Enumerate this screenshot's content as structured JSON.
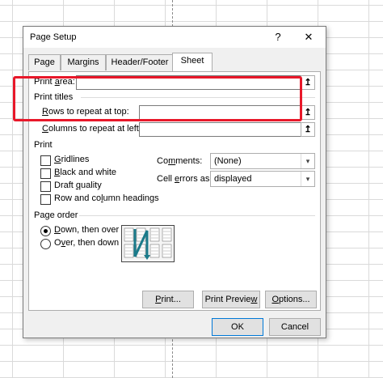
{
  "dialog": {
    "title": "Page Setup",
    "help_glyph": "?",
    "close_glyph": "✕"
  },
  "tabs": [
    "Page",
    "Margins",
    "Header/Footer",
    "Sheet"
  ],
  "sheet": {
    "print_area": {
      "label_u": "a",
      "label_rest": "rea:",
      "label_pre": "Print "
    },
    "print_titles": {
      "heading": "Print titles"
    },
    "rows_repeat": {
      "label_u": "R",
      "label_rest": "ows to repeat at top:"
    },
    "cols_repeat": {
      "label_u": "C",
      "label_rest": "olumns to repeat at left:"
    },
    "print": {
      "heading": "Print",
      "gridlines": {
        "u": "G",
        "rest": "ridlines"
      },
      "black_white": {
        "u": "B",
        "rest": "lack and white"
      },
      "draft": {
        "pre": "Draft ",
        "u": "q",
        "rest": "uality"
      },
      "headings": {
        "pre": "Row and co",
        "u": "l",
        "rest": "umn headings"
      },
      "comments_label": {
        "pre": "Co",
        "u": "m",
        "rest": "ments:"
      },
      "comments_value": "(None)",
      "errors_label": {
        "pre": "Cell ",
        "u": "e",
        "rest": "rrors as:"
      },
      "errors_value": "displayed"
    },
    "page_order": {
      "heading": "Page order",
      "down_over": {
        "u": "D",
        "rest": "own, then over"
      },
      "over_down": {
        "pre": "O",
        "u": "v",
        "rest": "er, then down"
      },
      "selected": "down_over"
    }
  },
  "buttons": {
    "print": {
      "u": "P",
      "rest": "rint..."
    },
    "print_preview": {
      "pre": "Print Previe",
      "u": "w",
      "rest": ""
    },
    "options": {
      "u": "O",
      "rest": "ptions..."
    },
    "ok": "OK",
    "cancel": "Cancel"
  },
  "icons": {
    "collapse": "↥",
    "dropdown": "▾"
  },
  "colors": {
    "highlight": "#e8182a",
    "accent": "#0078d7"
  }
}
